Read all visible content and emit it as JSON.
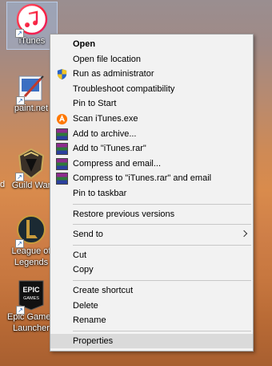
{
  "desktop": {
    "icons": [
      {
        "label": "iTunes"
      },
      {
        "label": "paint.net"
      },
      {
        "label": "Guild War"
      },
      {
        "label": "League of Legends"
      },
      {
        "label": "Epic Games Launcher"
      }
    ],
    "left_edge_letter": "d"
  },
  "context_menu": {
    "items": {
      "open": "Open",
      "open_file_location": "Open file location",
      "run_as_admin": "Run as administrator",
      "troubleshoot": "Troubleshoot compatibility",
      "pin_to_start": "Pin to Start",
      "scan": "Scan iTunes.exe",
      "add_to_archive": "Add to archive...",
      "add_to_rar": "Add to \"iTunes.rar\"",
      "compress_email": "Compress and email...",
      "compress_rar_email": "Compress to \"iTunes.rar\" and email",
      "pin_taskbar": "Pin to taskbar",
      "restore_versions": "Restore previous versions",
      "send_to": "Send to",
      "cut": "Cut",
      "copy": "Copy",
      "create_shortcut": "Create shortcut",
      "delete": "Delete",
      "rename": "Rename",
      "properties": "Properties"
    },
    "icons": {
      "uac": "shield-icon",
      "avast": "avast-icon",
      "winrar": "winrar-icon"
    },
    "colors": {
      "menu_bg": "#f2f2f2",
      "hover_bg": "#dadada",
      "separator": "#c8c8c8"
    }
  }
}
